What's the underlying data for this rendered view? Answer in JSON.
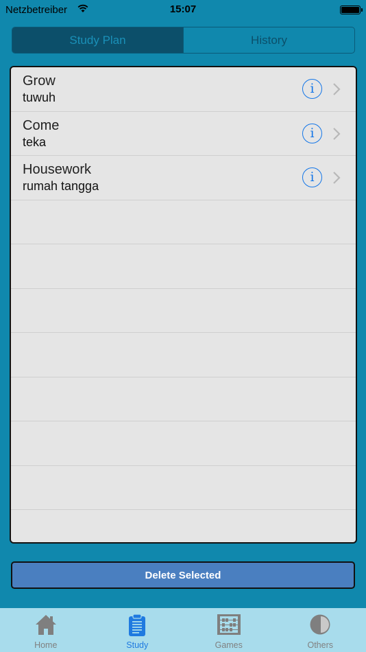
{
  "status_bar": {
    "carrier": "Netzbetreiber",
    "time": "15:07"
  },
  "segmented": {
    "tabs": [
      {
        "label": "Study Plan",
        "active": true
      },
      {
        "label": "History",
        "active": false
      }
    ]
  },
  "list": {
    "items": [
      {
        "word": "Grow",
        "meaning": "tuwuh"
      },
      {
        "word": "Come",
        "meaning": "teka"
      },
      {
        "word": "Housework",
        "meaning": "rumah tangga"
      }
    ],
    "info_glyph": "i",
    "empty_rows": 8
  },
  "delete_button": {
    "label": "Delete Selected"
  },
  "tab_bar": {
    "tabs": [
      {
        "label": "Home",
        "icon": "home-icon",
        "active": false
      },
      {
        "label": "Study",
        "icon": "clipboard-icon",
        "active": true
      },
      {
        "label": "Games",
        "icon": "abacus-icon",
        "active": false
      },
      {
        "label": "Others",
        "icon": "half-circle-icon",
        "active": false
      }
    ]
  },
  "colors": {
    "background": "#1088ad",
    "accent_blue": "#1577e8",
    "button_blue": "#4a7fc0",
    "tab_bar": "#a8dcec"
  }
}
